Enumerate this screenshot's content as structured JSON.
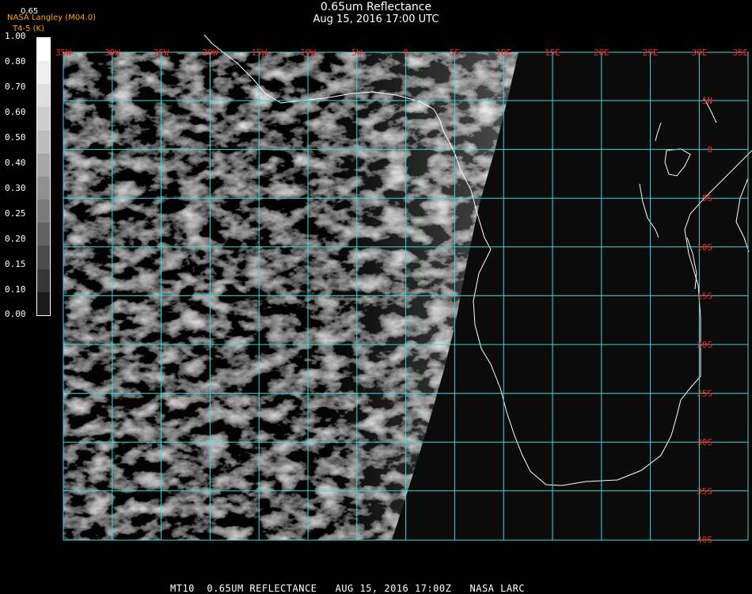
{
  "title": "0.65um Reflectance",
  "subtitle": "Aug 15, 2016 17:00 UTC",
  "credit": {
    "line1": "NASA Langley (M04.0)",
    "line2": "T4-5 (K)"
  },
  "legend_top": "0.65",
  "colorbar": {
    "labels": [
      "1.00",
      "0.80",
      "0.70",
      "0.60",
      "0.50",
      "0.40",
      "0.30",
      "0.25",
      "0.20",
      "0.15",
      "0.10",
      "0.00"
    ],
    "bands": [
      "#ffffff",
      "#efefef",
      "#dedede",
      "#cdcdcd",
      "#bcbcbc",
      "#a6a6a6",
      "#909090",
      "#7a7a7a",
      "#626262",
      "#4c4c4c",
      "#363636",
      "#1a1a1a"
    ]
  },
  "grid": {
    "lon_labels": [
      "35W",
      "30W",
      "25W",
      "20W",
      "15W",
      "10W",
      "5W",
      "0",
      "5E",
      "10E",
      "15E",
      "20E",
      "25E",
      "30E",
      "35E"
    ],
    "lat_labels": [
      "5N",
      "0",
      "5S",
      "10S",
      "15S",
      "20S",
      "25S",
      "30S",
      "35S",
      "40S"
    ],
    "grid_color": "#39d8e0",
    "label_color": "#ff2020"
  },
  "footer": "MT10  0.65UM REFLECTANCE   AUG 15, 2016 17:00Z   NASA LARC"
}
